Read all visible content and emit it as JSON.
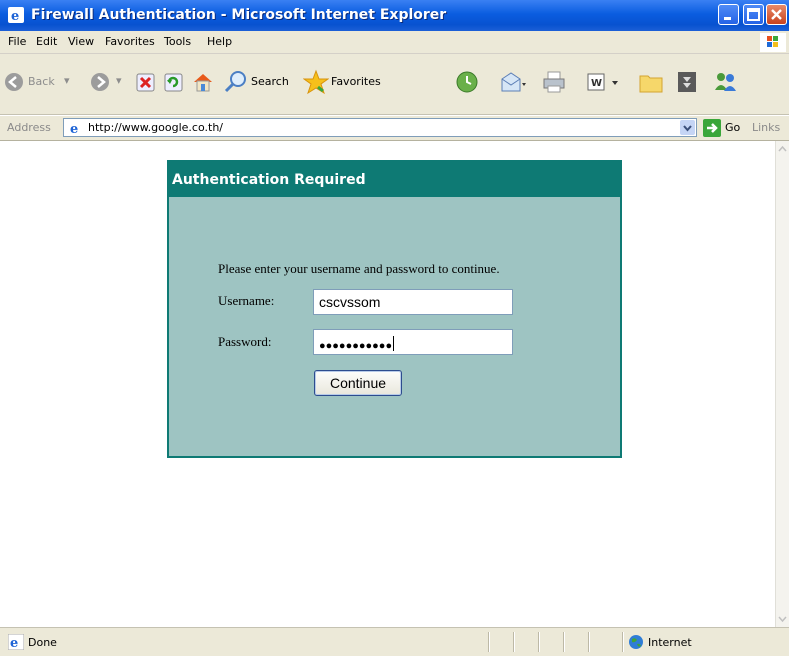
{
  "window": {
    "title": "Firewall Authentication - Microsoft Internet Explorer",
    "colors": {
      "titlebar": "#0a5de0",
      "chrome": "#ece9d8"
    }
  },
  "menu": {
    "items": [
      {
        "label": "File"
      },
      {
        "label": "Edit"
      },
      {
        "label": "View"
      },
      {
        "label": "Favorites"
      },
      {
        "label": "Tools"
      },
      {
        "label": "Help"
      }
    ]
  },
  "toolbar": {
    "back_label": "Back",
    "search_label": "Search",
    "favorites_label": "Favorites",
    "icons": [
      "back-icon",
      "forward-icon",
      "stop-icon",
      "refresh-icon",
      "home-icon",
      "search-icon",
      "favorites-icon",
      "history-icon",
      "mail-icon",
      "print-icon",
      "edit-icon",
      "folder-icon",
      "research-icon",
      "messenger-icon"
    ]
  },
  "address": {
    "label": "Address",
    "url": "http://www.google.co.th/",
    "go_label": "Go",
    "links_label": "Links"
  },
  "auth": {
    "header": "Authentication Required",
    "instruction": "Please enter your username and password to continue.",
    "username_label": "Username:",
    "username_value": "cscvssom",
    "password_label": "Password:",
    "password_value": "●●●●●●●●●●●",
    "continue_label": "Continue",
    "colors": {
      "header": "#0e7a74",
      "panel": "#9ec4c2"
    }
  },
  "status": {
    "text": "Done",
    "zone": "Internet"
  }
}
